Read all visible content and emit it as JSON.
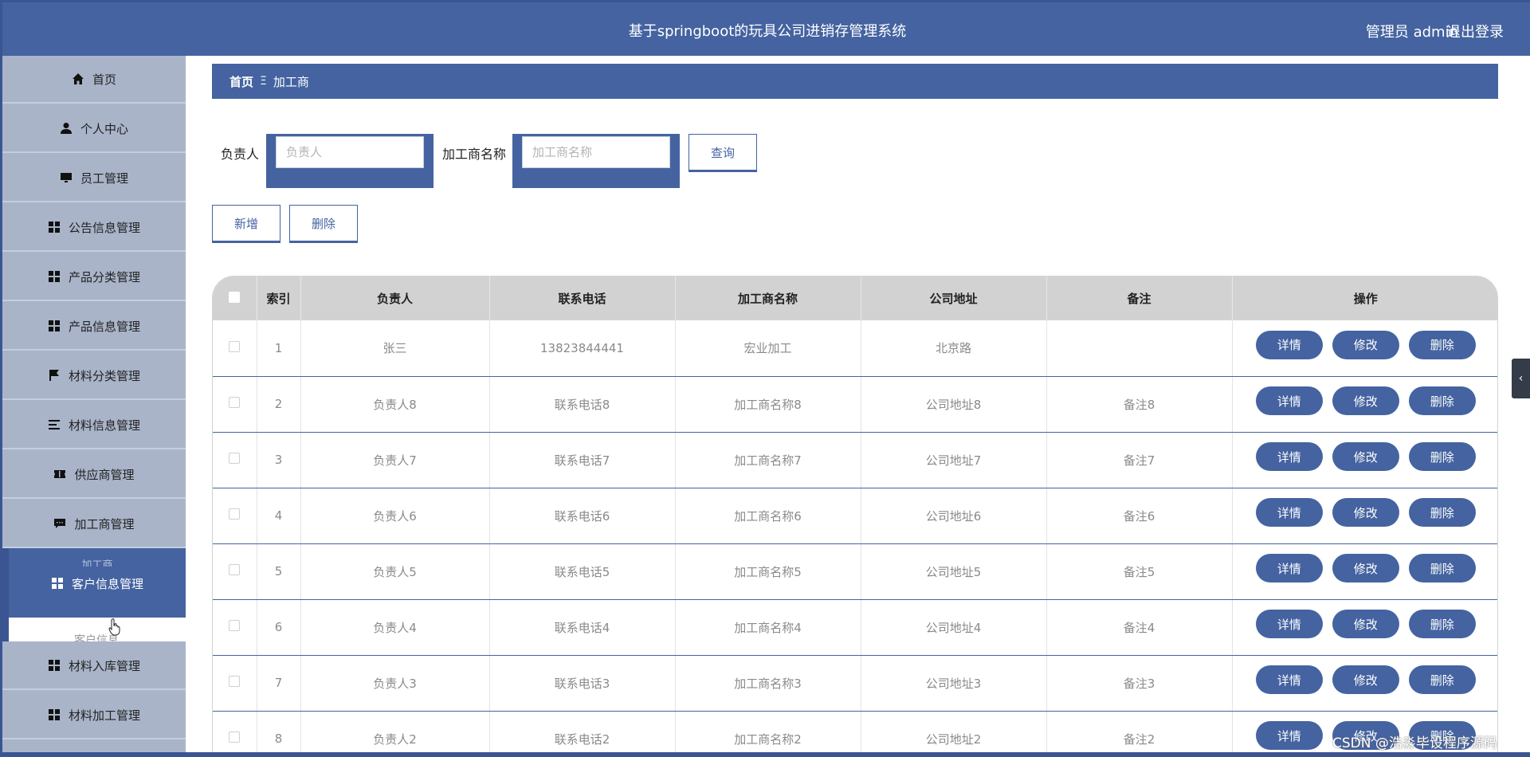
{
  "header": {
    "title": "基于springboot的玩具公司进销存管理系统",
    "user_label": "管理员 admin",
    "logout_label": "退出登录",
    "brand_color": "#4463a0"
  },
  "sidebar": {
    "items": [
      {
        "label": "首页",
        "icon": "home-icon"
      },
      {
        "label": "个人中心",
        "icon": "person-icon"
      },
      {
        "label": "员工管理",
        "icon": "monitor-icon"
      },
      {
        "label": "公告信息管理",
        "icon": "grid-icon"
      },
      {
        "label": "产品分类管理",
        "icon": "grid-icon"
      },
      {
        "label": "产品信息管理",
        "icon": "grid-icon"
      },
      {
        "label": "材料分类管理",
        "icon": "flag-icon"
      },
      {
        "label": "材料信息管理",
        "icon": "list-icon"
      },
      {
        "label": "供应商管理",
        "icon": "ticket-icon"
      },
      {
        "label": "加工商管理",
        "icon": "message-icon"
      },
      {
        "label": "客户信息管理",
        "icon": "grid-icon",
        "ghost_label": "加工商"
      },
      {
        "label": "材料入库管理",
        "icon": "grid-icon"
      },
      {
        "label": "材料加工管理",
        "icon": "grid-icon"
      }
    ],
    "submenu_label": "客户信息"
  },
  "breadcrumb": {
    "home": "首页",
    "separator": "Ξ",
    "current": "加工商"
  },
  "filters": {
    "owner_label": "负责人",
    "owner_placeholder": "负责人",
    "processor_label": "加工商名称",
    "processor_placeholder": "加工商名称",
    "search_label": "查询"
  },
  "toolbar": {
    "add_label": "新增",
    "delete_label": "删除"
  },
  "table": {
    "columns": [
      "索引",
      "负责人",
      "联系电话",
      "加工商名称",
      "公司地址",
      "备注",
      "操作"
    ],
    "actions": {
      "detail": "详情",
      "edit": "修改",
      "delete": "删除"
    },
    "rows": [
      {
        "index": "1",
        "owner": "张三",
        "phone": "13823844441",
        "name": "宏业加工",
        "address": "北京路",
        "remark": ""
      },
      {
        "index": "2",
        "owner": "负责人8",
        "phone": "联系电话8",
        "name": "加工商名称8",
        "address": "公司地址8",
        "remark": "备注8"
      },
      {
        "index": "3",
        "owner": "负责人7",
        "phone": "联系电话7",
        "name": "加工商名称7",
        "address": "公司地址7",
        "remark": "备注7"
      },
      {
        "index": "4",
        "owner": "负责人6",
        "phone": "联系电话6",
        "name": "加工商名称6",
        "address": "公司地址6",
        "remark": "备注6"
      },
      {
        "index": "5",
        "owner": "负责人5",
        "phone": "联系电话5",
        "name": "加工商名称5",
        "address": "公司地址5",
        "remark": "备注5"
      },
      {
        "index": "6",
        "owner": "负责人4",
        "phone": "联系电话4",
        "name": "加工商名称4",
        "address": "公司地址4",
        "remark": "备注4"
      },
      {
        "index": "7",
        "owner": "负责人3",
        "phone": "联系电话3",
        "name": "加工商名称3",
        "address": "公司地址3",
        "remark": "备注3"
      },
      {
        "index": "8",
        "owner": "负责人2",
        "phone": "联系电话2",
        "name": "加工商名称2",
        "address": "公司地址2",
        "remark": "备注2"
      }
    ]
  },
  "watermark": "CSDN @浩淼毕设程序源码"
}
